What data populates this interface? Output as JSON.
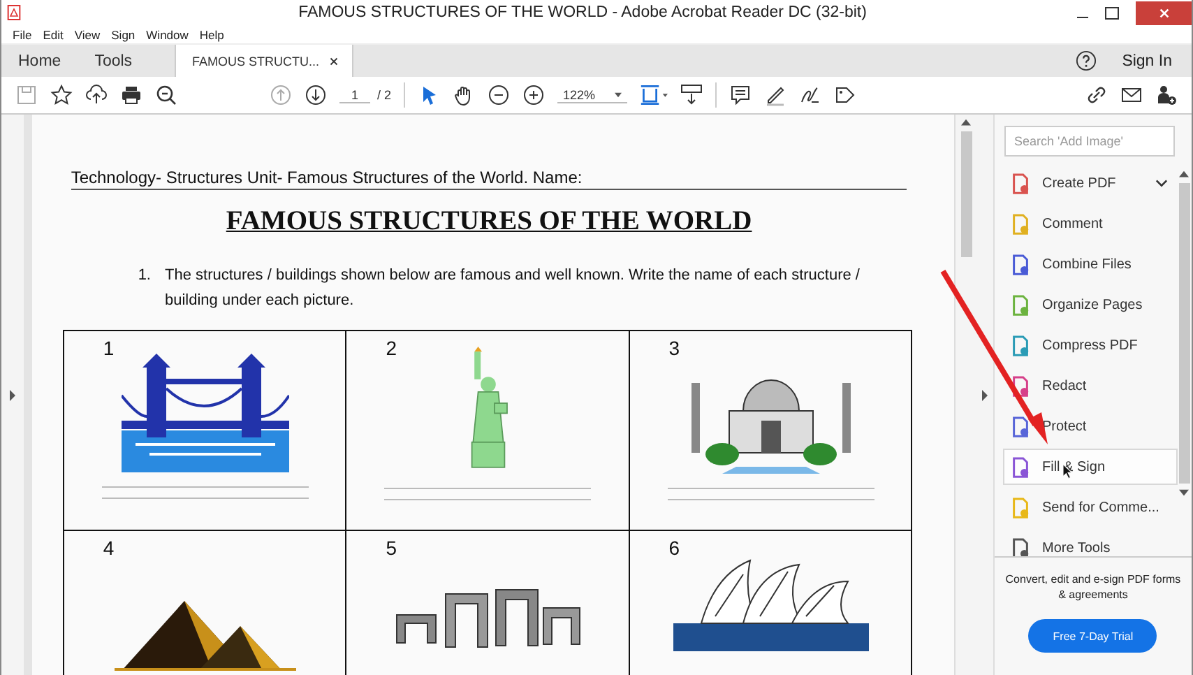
{
  "window": {
    "title": "FAMOUS STRUCTURES OF THE WORLD - Adobe Acrobat Reader DC (32-bit)"
  },
  "menu": [
    "File",
    "Edit",
    "View",
    "Sign",
    "Window",
    "Help"
  ],
  "tabs": [
    {
      "label": "Home",
      "selected": false
    },
    {
      "label": "Tools",
      "selected": false
    },
    {
      "label": "FAMOUS STRUCTU...",
      "selected": true,
      "closable": true
    }
  ],
  "sign_in": "Sign In",
  "toolbar": {
    "page": "1",
    "page_total": "/ 2",
    "zoom": "122%"
  },
  "document": {
    "header": "Technology- Structures Unit- Famous Structures of the World. Name:",
    "title": "FAMOUS STRUCTURES OF THE WORLD",
    "instruction_number": "1.",
    "instruction": "The structures / buildings shown below are famous and well known. Write the name of each structure / building under each picture.",
    "cells": [
      {
        "number": "1"
      },
      {
        "number": "2"
      },
      {
        "number": "3"
      },
      {
        "number": "4"
      },
      {
        "number": "5"
      },
      {
        "number": "6"
      }
    ]
  },
  "tools_panel": {
    "search": {
      "placeholder": "Search 'Add Image'"
    },
    "tools": [
      {
        "label": "Create PDF",
        "color": "#d9534f",
        "selected": false,
        "expandable": true
      },
      {
        "label": "Comment",
        "color": "#e0b020",
        "selected": false
      },
      {
        "label": "Combine Files",
        "color": "#4a5bd6",
        "selected": false
      },
      {
        "label": "Organize Pages",
        "color": "#6cb33f",
        "selected": false
      },
      {
        "label": "Compress PDF",
        "color": "#2a9bb5",
        "selected": false
      },
      {
        "label": "Redact",
        "color": "#d6408a",
        "selected": false
      },
      {
        "label": "Protect",
        "color": "#5865d8",
        "selected": false
      },
      {
        "label": "Fill & Sign",
        "color": "#8a55d6",
        "selected": true
      },
      {
        "label": "Send for Comme...",
        "color": "#e8b818",
        "selected": false
      },
      {
        "label": "More Tools",
        "color": "#555555",
        "selected": false
      }
    ],
    "promo": "Convert, edit and e-sign PDF forms & agreements",
    "trial_button": "Free 7-Day Trial"
  }
}
